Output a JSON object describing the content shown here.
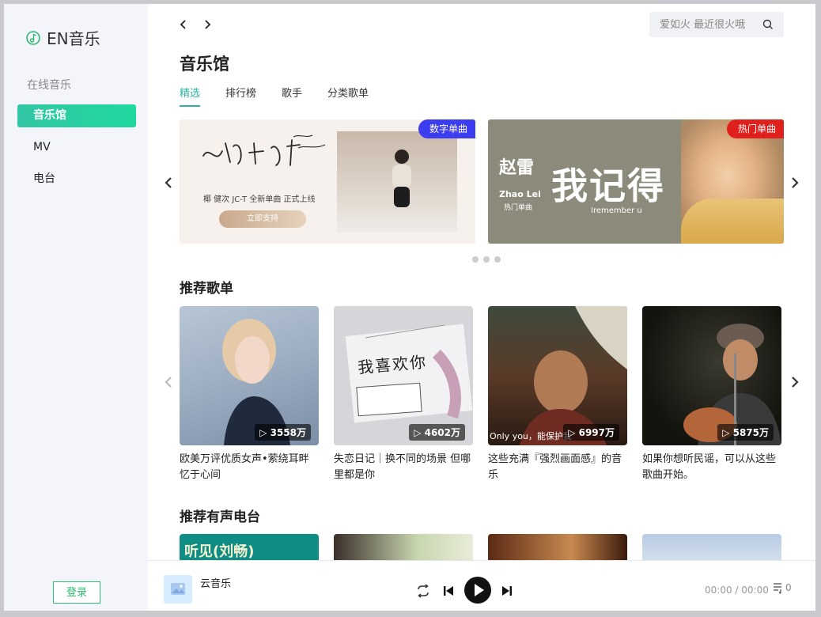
{
  "app": {
    "logo_text": "EN音乐",
    "section_label": "在线音乐",
    "nav_items": [
      {
        "label": "音乐馆",
        "active": true
      },
      {
        "label": "MV",
        "active": false
      },
      {
        "label": "电台",
        "active": false
      }
    ],
    "login_label": "登录",
    "accent": "#2eb3a3"
  },
  "search": {
    "placeholder": "爱如火 最近很火哦"
  },
  "page_title": "音乐馆",
  "tabs": [
    {
      "label": "精选",
      "active": true
    },
    {
      "label": "排行榜",
      "active": false
    },
    {
      "label": "歌手",
      "active": false
    },
    {
      "label": "分类歌单",
      "active": false
    }
  ],
  "banners": [
    {
      "tag": "数字单曲",
      "tag_color": "#3d3df0",
      "artist_line": "椰  健次  JC-T  全新单曲  正式上线",
      "button_label": "立即支持"
    },
    {
      "tag": "热门单曲",
      "tag_color": "#e0201c",
      "artist": "赵雷",
      "artist_en": "Zhao Lei",
      "subtitle": "热门单曲",
      "title": "我记得",
      "title_en": "Iremember u"
    }
  ],
  "recommended_playlists": {
    "title": "推荐歌单",
    "items": [
      {
        "title": "欧美万评优质女声•萦绕耳畔忆于心间",
        "plays": "3558万"
      },
      {
        "title": "失恋日记｜换不同的场景 但哪里都是你",
        "plays": "4602万",
        "cover_text": "我喜欢你"
      },
      {
        "title": "这些充满『强烈画面感』的音乐",
        "plays": "6997万",
        "cover_caption": "Only you，能保护我"
      },
      {
        "title": "如果你想听民谣，可以从这些歌曲开始。",
        "plays": "5875万"
      }
    ]
  },
  "recommended_radio": {
    "title": "推荐有声电台",
    "first_cover_text": "听见(刘畅)"
  },
  "player": {
    "song_name": "云音乐",
    "time": "00:00 / 00:00",
    "queue_count": "0"
  }
}
